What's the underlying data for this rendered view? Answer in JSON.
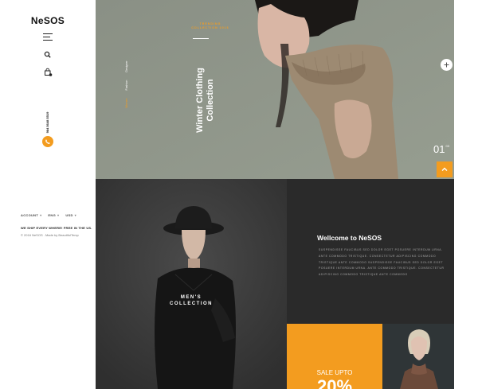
{
  "brand": {
    "logo": "NeSOS"
  },
  "sidebar": {
    "menu_icon": "hamburger-menu-icon",
    "search_icon": "search-icon",
    "cart_icon": "shopping-bag-icon",
    "phone_text": "984 5648 5519",
    "phone_icon": "phone-icon",
    "selects": [
      {
        "label": "ACCOUNT",
        "icon": "chevron-down-icon"
      },
      {
        "label": "ENG",
        "icon": "chevron-down-icon"
      },
      {
        "label": "USD",
        "icon": "chevron-down-icon"
      }
    ],
    "shipping": "WE SHIP EVERY WHERE! FREE IN THE US.",
    "copyright": "© 2016 NeSOS . Made by BeautifulTemp"
  },
  "hero": {
    "tagline": "TRENDING COLLECTION 2016",
    "title": "Winter Clothing Collection",
    "categories": [
      "Women",
      "Fashion",
      "Designer"
    ],
    "slide_number": "01",
    "slide_total": "03",
    "plus_icon": "plus-icon",
    "up_icon": "chevron-up-icon",
    "down_icon": "chevron-down-icon"
  },
  "mens": {
    "label": "MEN'S\nCOLLECTION"
  },
  "welcome": {
    "title": "Wellcome to NeSOS",
    "body": "SUSPENDISSE FAUCIBUS SED DOLOR EGET POSUERE INTERDUM URNA. ANTE COMMODO TRISTIQUE. CONSECTETUR ADIPISCING COMMODO TRISTIQUE ANTE COMMODO SUSPENDISSE FAUCIBUS SED DOLOR EGET POSUERE INTERDUM URNA. ANTE COMMODO TRISTIQUE. CONSECTETUR ADIPISCING COMMODO TRISTIQUE ANTE COMMODO"
  },
  "sale": {
    "line1": "SALE UPTO",
    "percent": "20%"
  },
  "colors": {
    "accent": "#f39c1f",
    "dark": "#2a2a2a",
    "hero_bg": "#8e9688"
  }
}
